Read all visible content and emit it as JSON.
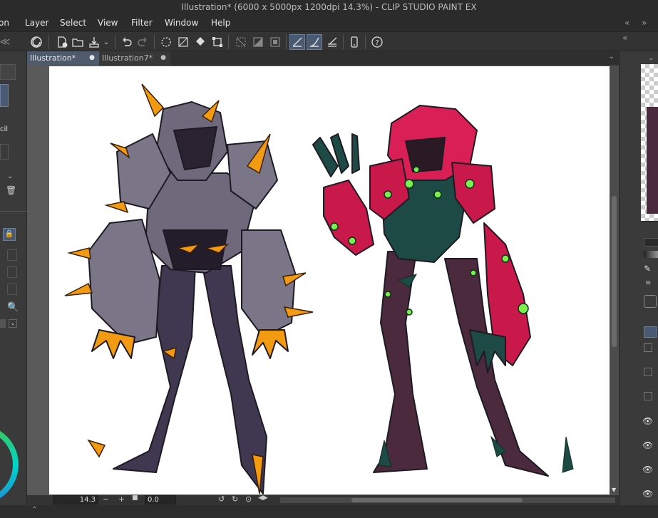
{
  "window": {
    "title": "Illustration* (6000 x 5000px 1200dpi 14.3%) - CLIP STUDIO PAINT EX"
  },
  "menu": {
    "items": [
      "on",
      "Layer",
      "Select",
      "View",
      "Filter",
      "Window",
      "Help"
    ]
  },
  "tabs": [
    {
      "label": "Illustration*"
    },
    {
      "label": "Illustration7*"
    }
  ],
  "left_panel": {
    "tool_fragment": "cil"
  },
  "status": {
    "zoom": "14.3",
    "rotation": "0.0"
  },
  "colors": {
    "accent": "#4a5a72",
    "canvas": "#ffffff",
    "chrome": "#2b2b2b"
  }
}
